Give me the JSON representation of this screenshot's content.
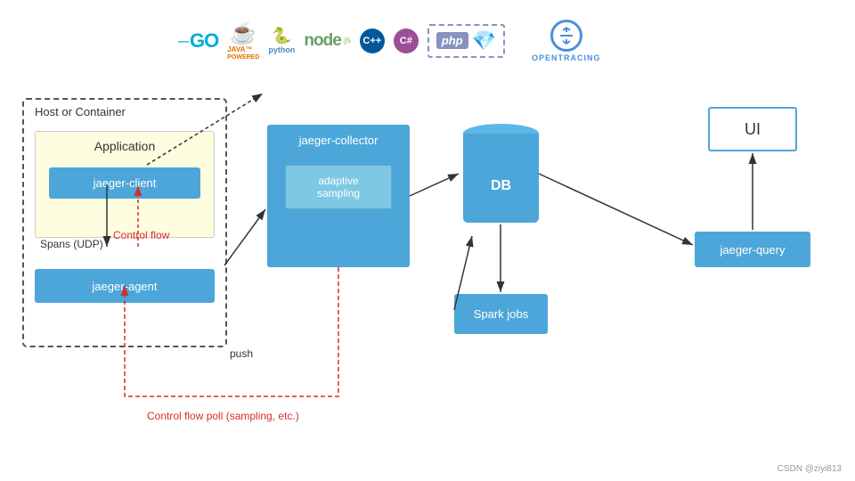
{
  "logos": {
    "go": "GO",
    "java": "Java™",
    "java_powered": "POWERED",
    "python": "python",
    "node": "node",
    "cpp": "C++",
    "csharp": "C#",
    "php": "php",
    "opentracing": "OPENTRACING"
  },
  "diagram": {
    "host_label": "Host or Container",
    "app_label": "Application",
    "jaeger_client": "jaeger-client",
    "jaeger_agent": "jaeger-agent",
    "jaeger_collector": "jaeger-collector",
    "adaptive_sampling": "adaptive\nsampling",
    "db": "DB",
    "spark_jobs": "Spark jobs",
    "jaeger_query": "jaeger-query",
    "ui": "UI",
    "spans_label": "Spans\n(UDP)",
    "control_flow": "Control flow",
    "push_label": "push",
    "control_flow_bottom": "Control flow poll\n(sampling, etc.)"
  },
  "watermark": "CSDN @ziyi813"
}
